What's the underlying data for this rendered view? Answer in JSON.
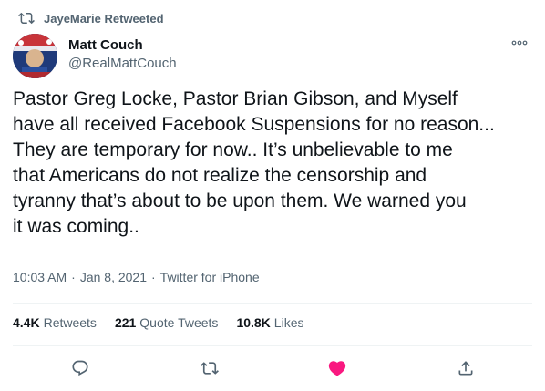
{
  "retweet_banner": {
    "icon": "retweet-icon",
    "text": "JayeMarie Retweeted"
  },
  "author": {
    "display_name": "Matt Couch",
    "handle": "@RealMattCouch",
    "avatar": "avatar-image"
  },
  "more_icon": "more-options-icon",
  "tweet": {
    "text": "Pastor Greg Locke, Pastor Brian Gibson, and Myself\nhave all received Facebook Suspensions for no reason...\nThey are temporary for now.. It’s unbelievable to me\nthat Americans do not realize the censorship and\ntyranny that’s about to be upon them. We warned you\nit was coming.."
  },
  "meta": {
    "time": "10:03 AM",
    "separator": "·",
    "date": "Jan 8, 2021",
    "source": "Twitter for iPhone"
  },
  "stats": {
    "retweets_count": "4.4K",
    "retweets_label": "Retweets",
    "quotes_count": "221",
    "quotes_label": "Quote Tweets",
    "likes_count": "10.8K",
    "likes_label": "Likes"
  },
  "actions": {
    "reply_icon": "reply-icon",
    "retweet_icon": "retweet-icon",
    "like_icon": "heart-icon",
    "share_icon": "share-icon",
    "like_color": "#f91880"
  },
  "colors": {
    "text_primary": "#0f1419",
    "text_secondary": "#536471",
    "divider": "#eff3f4",
    "like_red": "#f91880"
  }
}
